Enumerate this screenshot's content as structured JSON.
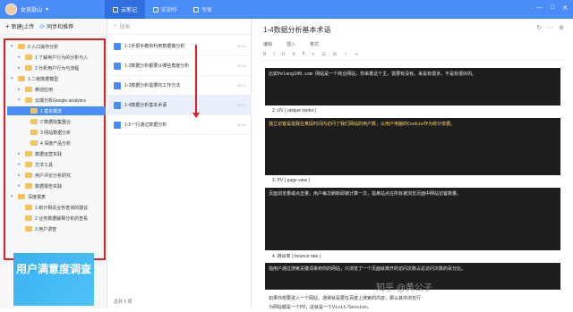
{
  "topbar": {
    "username": "女孩挺山",
    "tabs": [
      "云笔记",
      "实训作",
      "专家"
    ],
    "win": [
      "—",
      "□",
      "✕"
    ]
  },
  "sidebar": {
    "new_label": "新建|上传",
    "sync_label": "同步和推荐",
    "tree": [
      "0 入口操作分析",
      "1 了解用户行为的分析与入",
      "2 分析用户行为与流程",
      "1 二级数据模型",
      "移动应用",
      "云端分析Google analytics",
      "1 基本概念",
      "2 数据收集整合",
      "3 网站数据分析",
      "4 深度产品分析",
      "数据运营实践",
      "方法工具",
      "用户评论分析研究",
      "数据报告实践",
      "深度报表",
      "1 统计相关业务查询的建议",
      "2 业务数据解释分析的查看",
      "3 用户调查"
    ],
    "banner": "用户满意度调查"
  },
  "notelist": {
    "search_label": "搜索",
    "footer": "总共 5 项",
    "items": [
      "1-1手把手教你利用数据做分析",
      "1-2数据分析都要从哪些角度分析",
      "1-3数据分析需要的工作方法",
      "1-4数据分析基本术语",
      "1-5一行通过数据分析"
    ],
    "dates": [
      "08-01",
      "08-01",
      "08-01",
      "08-01",
      "08-01"
    ]
  },
  "editor": {
    "title": "1-4数据分析基本术语",
    "tabs": [
      "编辑",
      "插入",
      "格式"
    ],
    "tools": [
      "B",
      "I",
      "U",
      "S",
      "¶",
      "≡",
      "☰",
      "⊞",
      "⚐",
      "∞"
    ],
    "top_icons": [
      "↻",
      "⋯",
      "⊕"
    ],
    "h2": "2. UV ( unique visitor )",
    "h3": "3. PV ( page view )",
    "h4": "4. 跳出率 ( bounce rate )",
    "b1": "比如Yelang100.com 网站是一个商业网站，你来着这个主，需要有没有。来是有很多，不是有很好的。",
    "b2": "独立访客是指我在某段时间内访问了我们网站的用户数，以用户电脑的Cookie作为统计依据。",
    "b3": "页面浏览量或点击量，用户每次刷新即被计算一次，指某站点在所有被浏览页面中网站访客数量。",
    "b4": "指用户通过搜索关键词来到你的网站，只浏览了一个页面就离开的访问次数占总访问次数的百分比。",
    "b5": "如果你想要进入一个网站，通常就是要在百度上搜索的内容，那么其中浏览行为网站都是一个PV，这就是一个Visit/Session。",
    "watermark": "知乎 @黄公子"
  }
}
